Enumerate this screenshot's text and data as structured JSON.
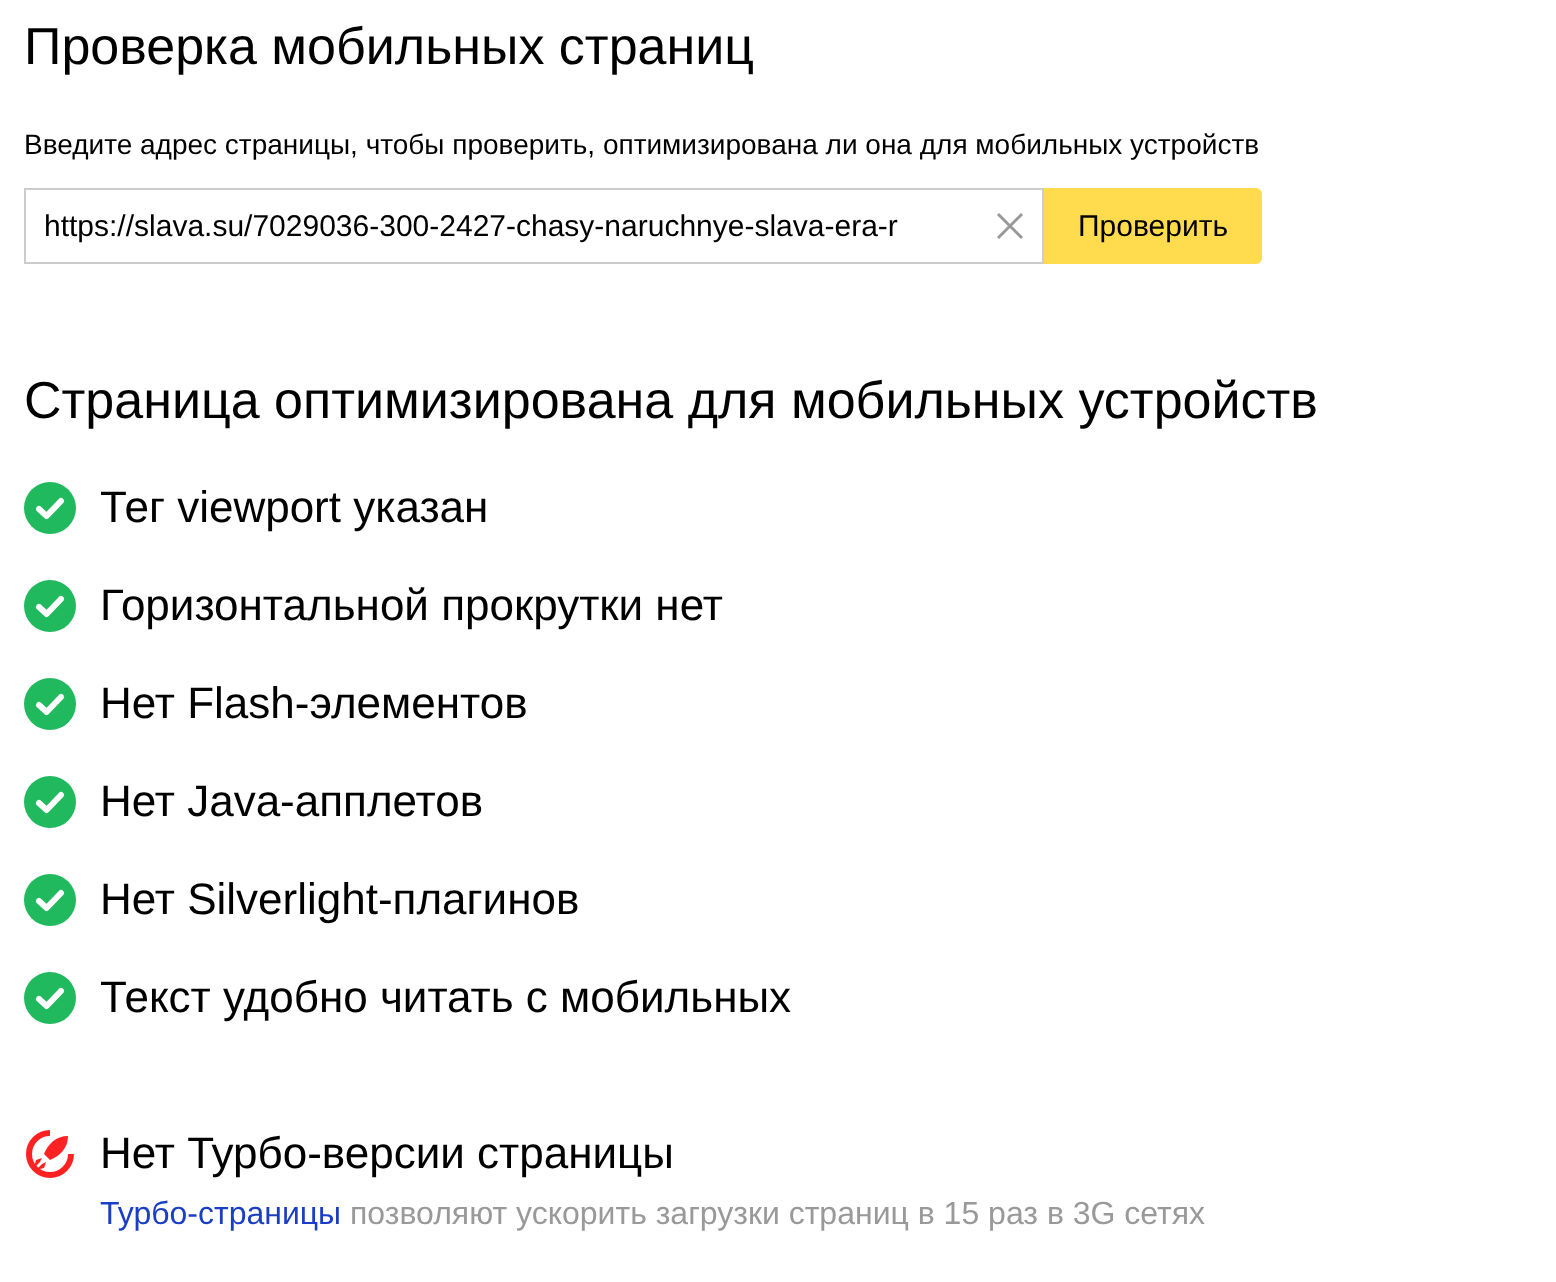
{
  "title": "Проверка мобильных страниц",
  "prompt": "Введите адрес страницы, чтобы проверить, оптимизирована ли она для мобильных устройств",
  "url_field": {
    "value": "https://slava.su/7029036-300-2427-chasy-naruchnye-slava-era-r"
  },
  "check_button": "Проверить",
  "result_heading": "Страница оптимизирована для мобильных устройств",
  "checks": [
    {
      "label": "Тег viewport указан",
      "passed": true
    },
    {
      "label": "Горизонтальной прокрутки нет",
      "passed": true
    },
    {
      "label": "Нет Flash-элементов",
      "passed": true
    },
    {
      "label": "Нет Java-апплетов",
      "passed": true
    },
    {
      "label": "Нет Silverlight-плагинов",
      "passed": true
    },
    {
      "label": "Текст удобно читать с мобильных",
      "passed": true
    }
  ],
  "turbo": {
    "label": "Нет Турбо-версии страницы",
    "link": "Турбо-страницы",
    "description": "позволяют ускорить загрузки страниц в 15 раз в 3G сетях"
  }
}
